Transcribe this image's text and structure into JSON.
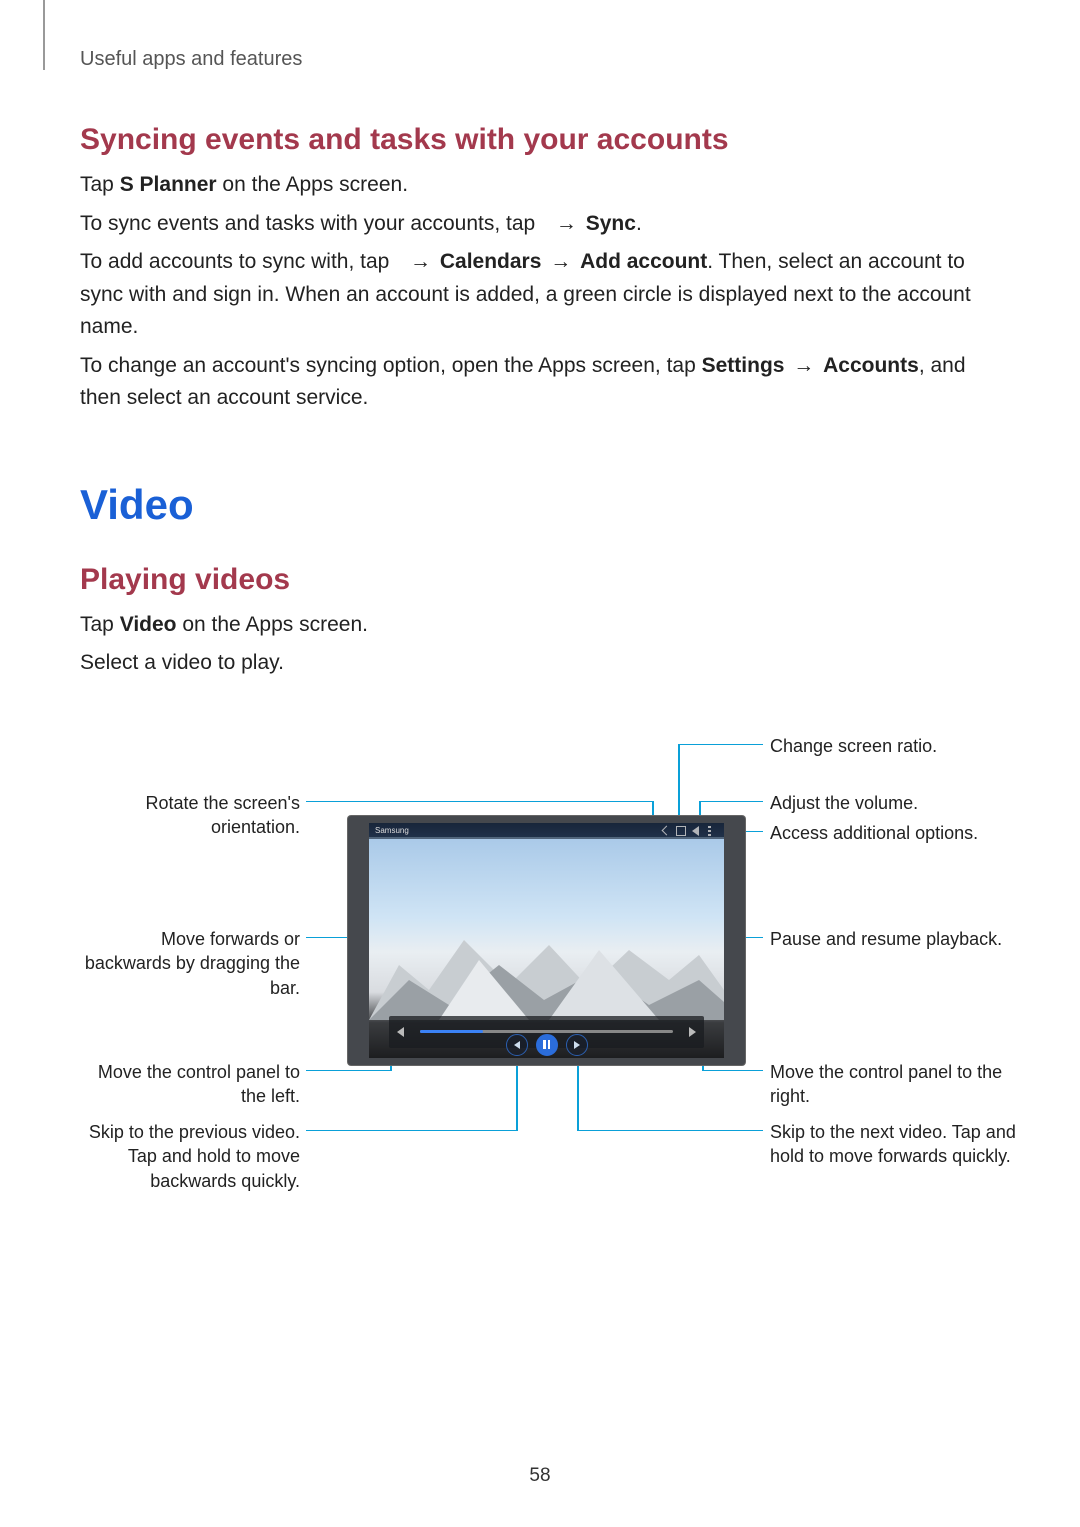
{
  "breadcrumb": "Useful apps and features",
  "section1": {
    "title": "Syncing events and tasks with your accounts",
    "p1_pre": "Tap ",
    "p1_bold": "S Planner",
    "p1_post": " on the Apps screen.",
    "p2_pre": "To sync events and tasks with your accounts, tap ",
    "p2_arrow": " → ",
    "p2_bold": "Sync",
    "p2_post": ".",
    "p3_pre": "To add accounts to sync with, tap ",
    "p3_arrow1": " → ",
    "p3_bold1": "Calendars",
    "p3_arrow2": " → ",
    "p3_bold2": "Add account",
    "p3_post": ". Then, select an account to sync with and sign in. When an account is added, a green circle is displayed next to the account name.",
    "p4_pre": "To change an account's syncing option, open the Apps screen, tap ",
    "p4_bold1": "Settings",
    "p4_arrow": " → ",
    "p4_bold2": "Accounts",
    "p4_post": ", and then select an account service."
  },
  "section2": {
    "title": "Video",
    "sub": "Playing videos",
    "p1_pre": "Tap ",
    "p1_bold": "Video",
    "p1_post": " on the Apps screen.",
    "p2": "Select a video to play."
  },
  "player": {
    "title": "Samsung"
  },
  "callouts": {
    "left": {
      "rotate": "Rotate the screen's orientation.",
      "seek": "Move forwards or backwards by dragging the bar.",
      "panel_left": "Move the control panel to the left.",
      "prev": "Skip to the previous video. Tap and hold to move backwards quickly."
    },
    "right": {
      "ratio": "Change screen ratio.",
      "volume": "Adjust the volume.",
      "more": "Access additional options.",
      "pause": "Pause and resume playback.",
      "panel_right": "Move the control panel to the right.",
      "next": "Skip to the next video. Tap and hold to move forwards quickly."
    }
  },
  "page_number": "58"
}
